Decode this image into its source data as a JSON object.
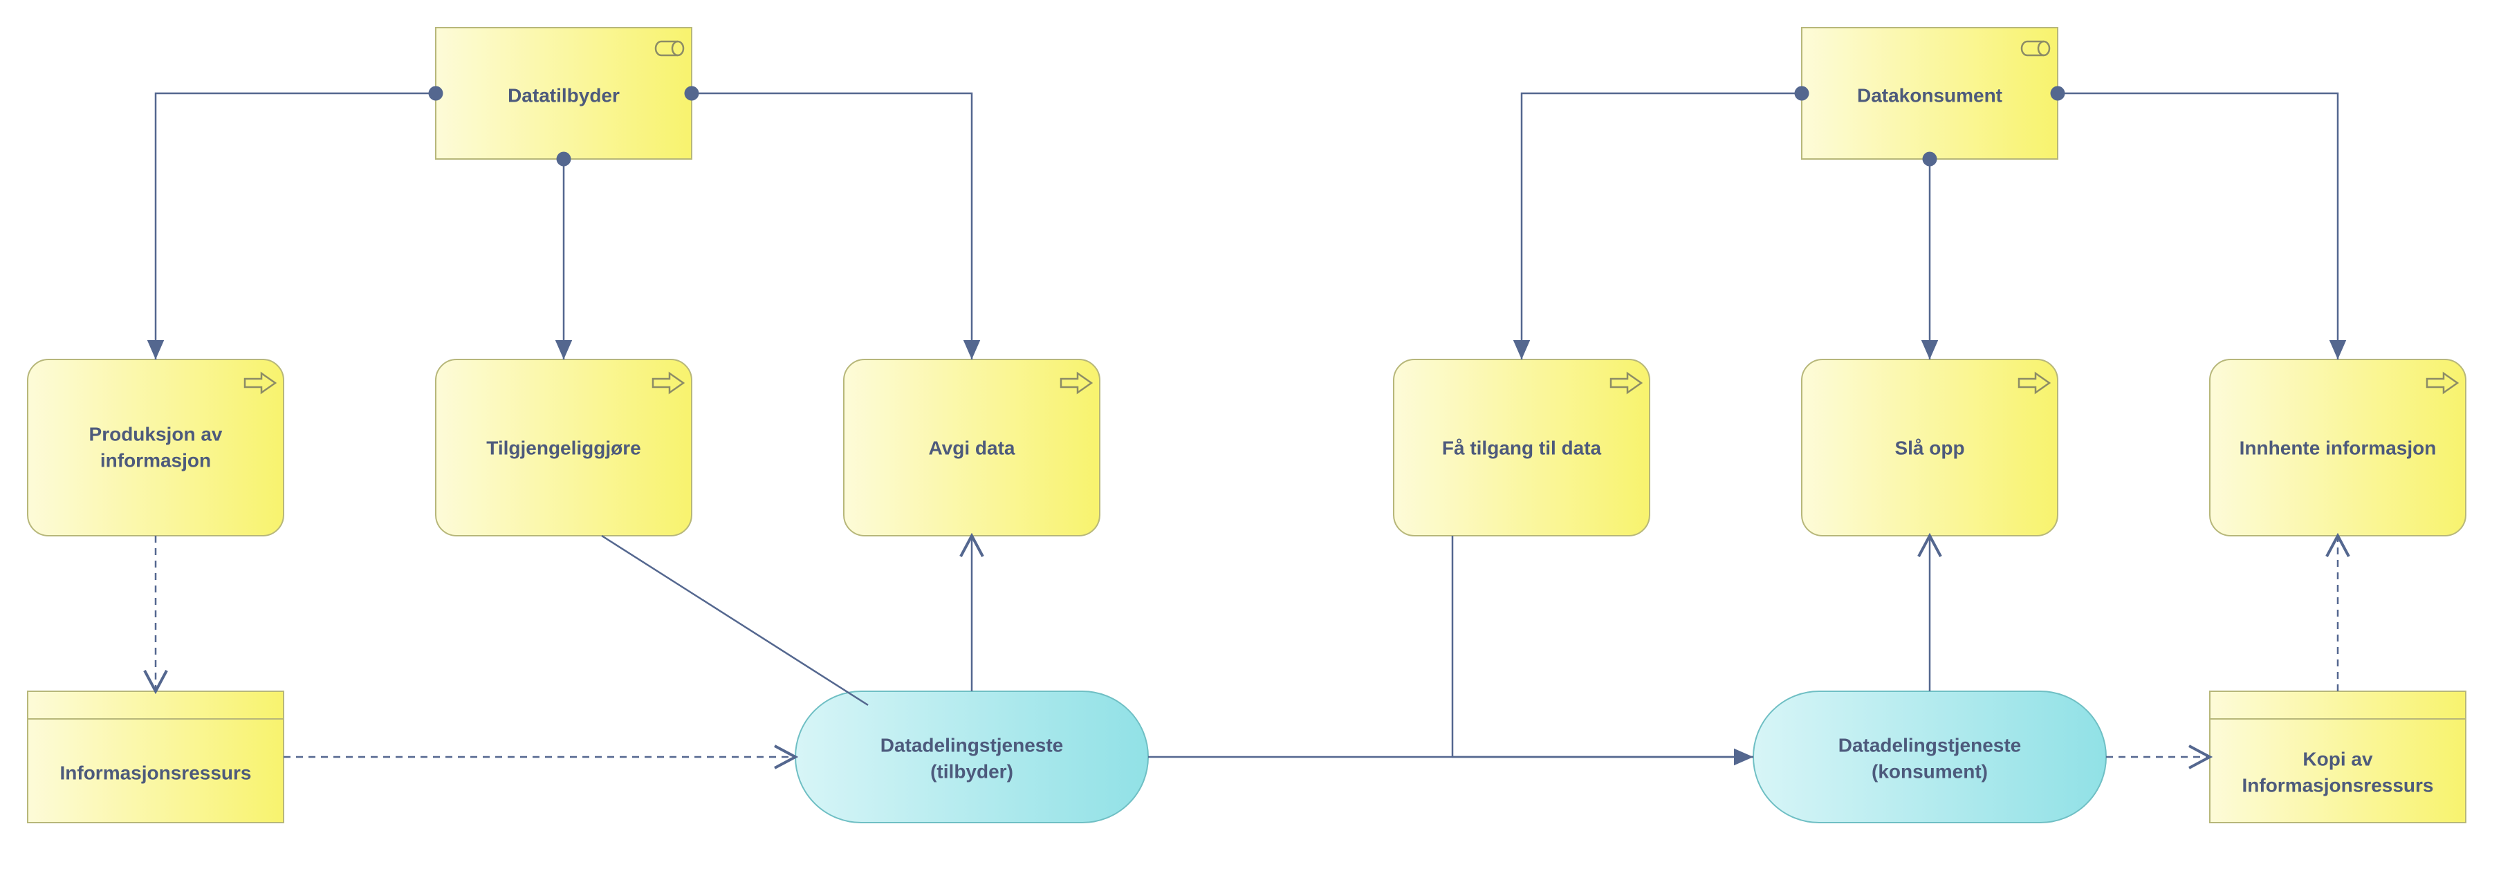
{
  "nodes": {
    "datatilbyder": {
      "label": "Datatilbyder"
    },
    "datakonsument": {
      "label": "Datakonsument"
    },
    "produksjon": {
      "line1": "Produksjon av",
      "line2": "informasjon"
    },
    "tilgjengelig": {
      "label": "Tilgjengeliggjøre"
    },
    "avgi": {
      "label": "Avgi data"
    },
    "fa_tilgang": {
      "label": "Få tilgang til data"
    },
    "sla_opp": {
      "label": "Slå opp"
    },
    "innhente": {
      "label": "Innhente informasjon"
    },
    "informasjonsressurs": {
      "label": "Informasjonsressurs"
    },
    "dds_tilbyder": {
      "line1": "Datadelingstjeneste",
      "line2": "(tilbyder)"
    },
    "dds_konsument": {
      "line1": "Datadelingstjeneste",
      "line2": "(konsument)"
    },
    "kopi": {
      "line1": "Kopi av",
      "line2": "Informasjonsressurs"
    }
  },
  "chart_data": {
    "type": "archimate_diagram",
    "roles": [
      {
        "id": "datatilbyder",
        "name": "Datatilbyder"
      },
      {
        "id": "datakonsument",
        "name": "Datakonsument"
      }
    ],
    "processes": [
      {
        "id": "produksjon",
        "name": "Produksjon av informasjon",
        "assigned_to": "datatilbyder"
      },
      {
        "id": "tilgjengelig",
        "name": "Tilgjengeliggjøre",
        "assigned_to": "datatilbyder"
      },
      {
        "id": "avgi",
        "name": "Avgi data",
        "assigned_to": "datatilbyder"
      },
      {
        "id": "fa_tilgang",
        "name": "Få tilgang til data",
        "assigned_to": "datakonsument"
      },
      {
        "id": "sla_opp",
        "name": "Slå opp",
        "assigned_to": "datakonsument"
      },
      {
        "id": "innhente",
        "name": "Innhente informasjon",
        "assigned_to": "datakonsument"
      }
    ],
    "data_objects": [
      {
        "id": "informasjonsressurs",
        "name": "Informasjonsressurs"
      },
      {
        "id": "kopi",
        "name": "Kopi av Informasjonsressurs"
      }
    ],
    "application_services": [
      {
        "id": "dds_tilbyder",
        "name": "Datadelingstjeneste (tilbyder)"
      },
      {
        "id": "dds_konsument",
        "name": "Datadelingstjeneste (konsument)"
      }
    ],
    "relations": [
      {
        "from": "datatilbyder",
        "to": "produksjon",
        "type": "assignment"
      },
      {
        "from": "datatilbyder",
        "to": "tilgjengelig",
        "type": "assignment"
      },
      {
        "from": "datatilbyder",
        "to": "avgi",
        "type": "assignment"
      },
      {
        "from": "datakonsument",
        "to": "fa_tilgang",
        "type": "assignment"
      },
      {
        "from": "datakonsument",
        "to": "sla_opp",
        "type": "assignment"
      },
      {
        "from": "datakonsument",
        "to": "innhente",
        "type": "assignment"
      },
      {
        "from": "produksjon",
        "to": "informasjonsressurs",
        "type": "access",
        "style": "dashed"
      },
      {
        "from": "informasjonsressurs",
        "to": "dds_tilbyder",
        "type": "access",
        "style": "dashed"
      },
      {
        "from": "tilgjengelig",
        "to": "dds_tilbyder",
        "type": "realization"
      },
      {
        "from": "dds_tilbyder",
        "to": "avgi",
        "type": "serving"
      },
      {
        "from": "dds_tilbyder",
        "to": "dds_konsument",
        "type": "triggering"
      },
      {
        "from": "fa_tilgang",
        "to": "dds_konsument",
        "type": "realization"
      },
      {
        "from": "dds_konsument",
        "to": "sla_opp",
        "type": "serving"
      },
      {
        "from": "dds_konsument",
        "to": "kopi",
        "type": "access",
        "style": "dashed"
      },
      {
        "from": "kopi",
        "to": "innhente",
        "type": "access",
        "style": "dashed"
      }
    ]
  }
}
